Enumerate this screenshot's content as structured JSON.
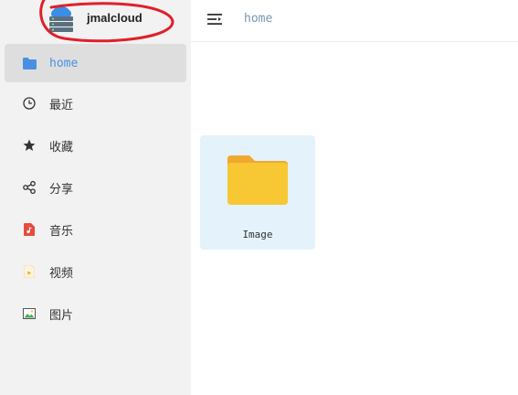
{
  "brand": {
    "name": "jmalcloud",
    "logo_icon": "cloud-server-icon"
  },
  "sidebar": {
    "items": [
      {
        "label": "home",
        "icon": "folder-icon",
        "active": true
      },
      {
        "label": "最近",
        "icon": "clock-icon",
        "active": false
      },
      {
        "label": "收藏",
        "icon": "star-icon",
        "active": false
      },
      {
        "label": "分享",
        "icon": "share-icon",
        "active": false
      },
      {
        "label": "音乐",
        "icon": "music-file-icon",
        "active": false
      },
      {
        "label": "视频",
        "icon": "video-file-icon",
        "active": false
      },
      {
        "label": "图片",
        "icon": "image-icon",
        "active": false
      }
    ]
  },
  "topbar": {
    "menu_icon": "menu-fold-icon",
    "breadcrumb": "home"
  },
  "files": [
    {
      "name": "Image",
      "type": "folder",
      "icon": "folder-icon"
    }
  ],
  "colors": {
    "accent": "#4a90e2",
    "sidebar_bg": "#f2f2f2",
    "active_bg": "#dedede",
    "card_bg": "#e3f2fb",
    "folder": "#f7c833",
    "annotation": "#e0202a"
  }
}
